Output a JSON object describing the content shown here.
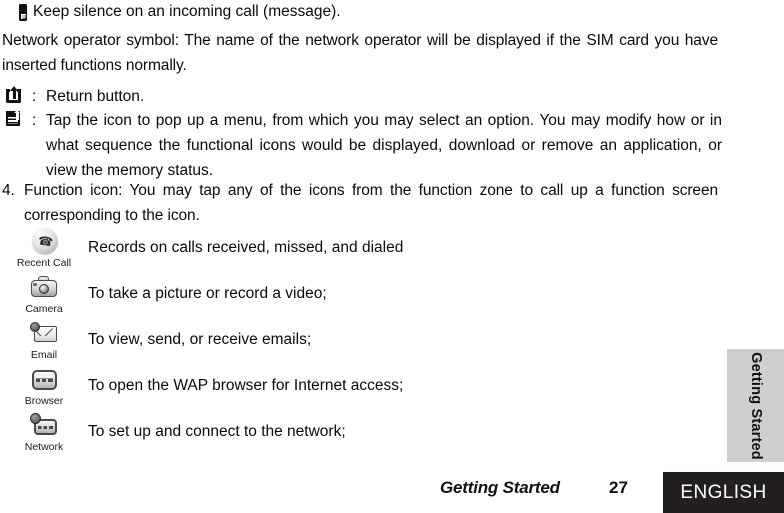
{
  "page": {
    "silence_note": "Keep silence on an incoming call (message).",
    "silence_icon": "mobile-phone-icon",
    "network_operator": "Network operator symbol: The name of the network operator will be displayed if the SIM card you have inserted functions normally.",
    "colon": ":",
    "return_icon": "return-button-icon",
    "return_text": "Return button.",
    "menu_icon": "menu-list-icon",
    "menu_text": "Tap the icon to pop up a menu, from which you may select an option. You may modify how or in what sequence the functional icons would be displayed, download or remove an application, or view the memory status.",
    "function_number": "4.",
    "function_text": "Function icon: You may tap any of the icons from the function zone to call up a function screen corresponding to the icon."
  },
  "apps": [
    {
      "icon": "recent-call-icon",
      "label": "Recent Call",
      "description": "Records on calls received, missed, and dialed"
    },
    {
      "icon": "camera-icon",
      "label": "Camera",
      "description": "To take a picture or record a video;"
    },
    {
      "icon": "email-icon",
      "label": "Email",
      "description": "To view, send, or receive emails;"
    },
    {
      "icon": "browser-icon",
      "label": "Browser",
      "description": "To open the WAP browser for Internet access;"
    },
    {
      "icon": "network-icon",
      "label": "Network",
      "description": "To set up and connect to the network;"
    }
  ],
  "chapter_tab": {
    "label": "Getting Started",
    "background": "#cfcfcf"
  },
  "footer": {
    "chapter": "Getting Started",
    "page_number": "27",
    "language": "ENGLISH",
    "language_background": "#231f20",
    "language_color": "#ffffff"
  }
}
